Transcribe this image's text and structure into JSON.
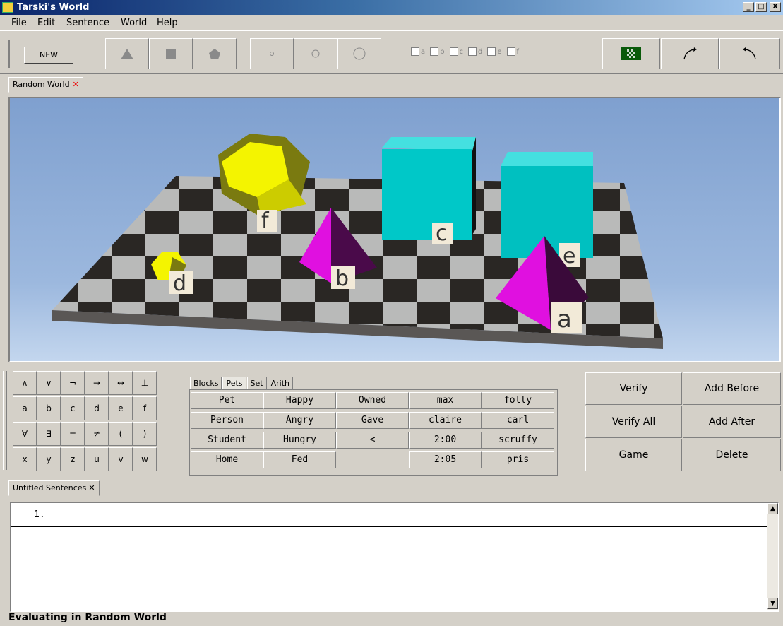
{
  "window": {
    "title": "Tarski's World",
    "minimize": "_",
    "maximize": "□",
    "close": "X"
  },
  "menu": [
    "File",
    "Edit",
    "Sentence",
    "World",
    "Help"
  ],
  "toolbar": {
    "new_label": "NEW",
    "checkboxes": [
      "a",
      "b",
      "c",
      "d",
      "e",
      "f"
    ]
  },
  "world_tab": {
    "label": "Random World"
  },
  "world_objects": {
    "labels": [
      "f",
      "c",
      "e",
      "d",
      "b",
      "a"
    ]
  },
  "keypad": {
    "keys": [
      [
        "∧",
        "∨",
        "¬",
        "→",
        "↔",
        "⊥"
      ],
      [
        "a",
        "b",
        "c",
        "d",
        "e",
        "f"
      ],
      [
        "∀",
        "∃",
        "=",
        "≠",
        "(",
        ")"
      ],
      [
        "x",
        "y",
        "z",
        "u",
        "v",
        "w"
      ]
    ]
  },
  "predicate_tabs": [
    "Blocks",
    "Pets",
    "Set",
    "Arith"
  ],
  "predicates": {
    "rows": [
      [
        "Pet",
        "Happy",
        "Owned",
        "max",
        "folly"
      ],
      [
        "Person",
        "Angry",
        "Gave",
        "claire",
        "carl"
      ],
      [
        "Student",
        "Hungry",
        "<",
        "2:00",
        "scruffy"
      ],
      [
        "Home",
        "Fed",
        "",
        "2:05",
        "pris"
      ]
    ]
  },
  "actions": {
    "verify": "Verify",
    "add_before": "Add Before",
    "verify_all": "Verify All",
    "add_after": "Add After",
    "game": "Game",
    "delete": "Delete"
  },
  "sentence_tab": {
    "label": "Untitled Sentences"
  },
  "sentences": [
    {
      "number": "1."
    }
  ],
  "status": "Evaluating in Random World"
}
